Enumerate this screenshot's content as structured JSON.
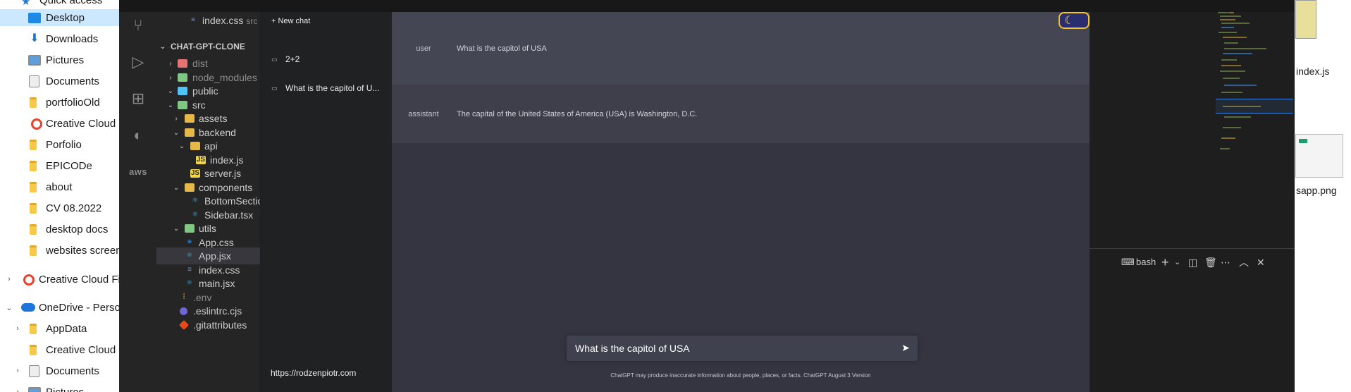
{
  "explorer": {
    "items": [
      {
        "label": "Quick access",
        "icon": "star-icon"
      },
      {
        "label": "Desktop",
        "icon": "desktop-icon",
        "selected": true
      },
      {
        "label": "Downloads",
        "icon": "download-icon"
      },
      {
        "label": "Pictures",
        "icon": "pictures-icon"
      },
      {
        "label": "Documents",
        "icon": "documents-icon"
      },
      {
        "label": "portfolioOld",
        "icon": "folder-icon"
      },
      {
        "label": "Creative Cloud F",
        "icon": "creative-cloud-icon"
      },
      {
        "label": "Porfolio",
        "icon": "folder-icon"
      },
      {
        "label": "EPICODe",
        "icon": "folder-icon"
      },
      {
        "label": "about",
        "icon": "folder-icon"
      },
      {
        "label": "CV 08.2022",
        "icon": "folder-icon"
      },
      {
        "label": "desktop docs",
        "icon": "folder-icon"
      },
      {
        "label": "websites screen",
        "icon": "folder-icon"
      },
      {
        "label": "Creative Cloud Fil",
        "icon": "creative-cloud-icon"
      },
      {
        "label": "OneDrive - Persor",
        "icon": "onedrive-icon"
      },
      {
        "label": "AppData",
        "icon": "folder-icon"
      },
      {
        "label": "Creative Cloud F",
        "icon": "folder-icon"
      },
      {
        "label": "Documents",
        "icon": "documents-icon"
      },
      {
        "label": "Pictures",
        "icon": "pictures-icon"
      }
    ]
  },
  "vscode": {
    "tree": {
      "top_file": {
        "label": "index.css",
        "suffix": "src"
      },
      "section": "CHAT-GPT-CLONE",
      "rows": [
        {
          "label": "dist"
        },
        {
          "label": "node_modules"
        },
        {
          "label": "public"
        },
        {
          "label": "src"
        },
        {
          "label": "assets"
        },
        {
          "label": "backend"
        },
        {
          "label": "api"
        },
        {
          "label": "index.js"
        },
        {
          "label": "server.js"
        },
        {
          "label": "components"
        },
        {
          "label": "BottomSection"
        },
        {
          "label": "Sidebar.tsx"
        },
        {
          "label": "utils"
        },
        {
          "label": "App.css"
        },
        {
          "label": "App.jsx"
        },
        {
          "label": "index.css"
        },
        {
          "label": "main.jsx"
        },
        {
          "label": ".env"
        },
        {
          "label": ".eslintrc.cjs"
        },
        {
          "label": ".gitattributes"
        }
      ]
    },
    "terminal": {
      "shell_label": "bash"
    }
  },
  "app": {
    "new_chat": "+ New chat",
    "history": [
      "2+2",
      "What is the capitol of U..."
    ],
    "link": "https://rodzenpiotr.com",
    "messages": [
      {
        "role": "user",
        "text": "What is the capitol of USA"
      },
      {
        "role": "assistant",
        "text": "The capital of the United States of America (USA) is Washington, D.C."
      }
    ],
    "input_value": "What is the capitol of USA",
    "footnote": "ChatGPT may produce inaccurate information about people, places, or facts. ChatGPT August 3 Version"
  },
  "desktop": {
    "files": [
      "index.js",
      "sapp.png"
    ]
  }
}
